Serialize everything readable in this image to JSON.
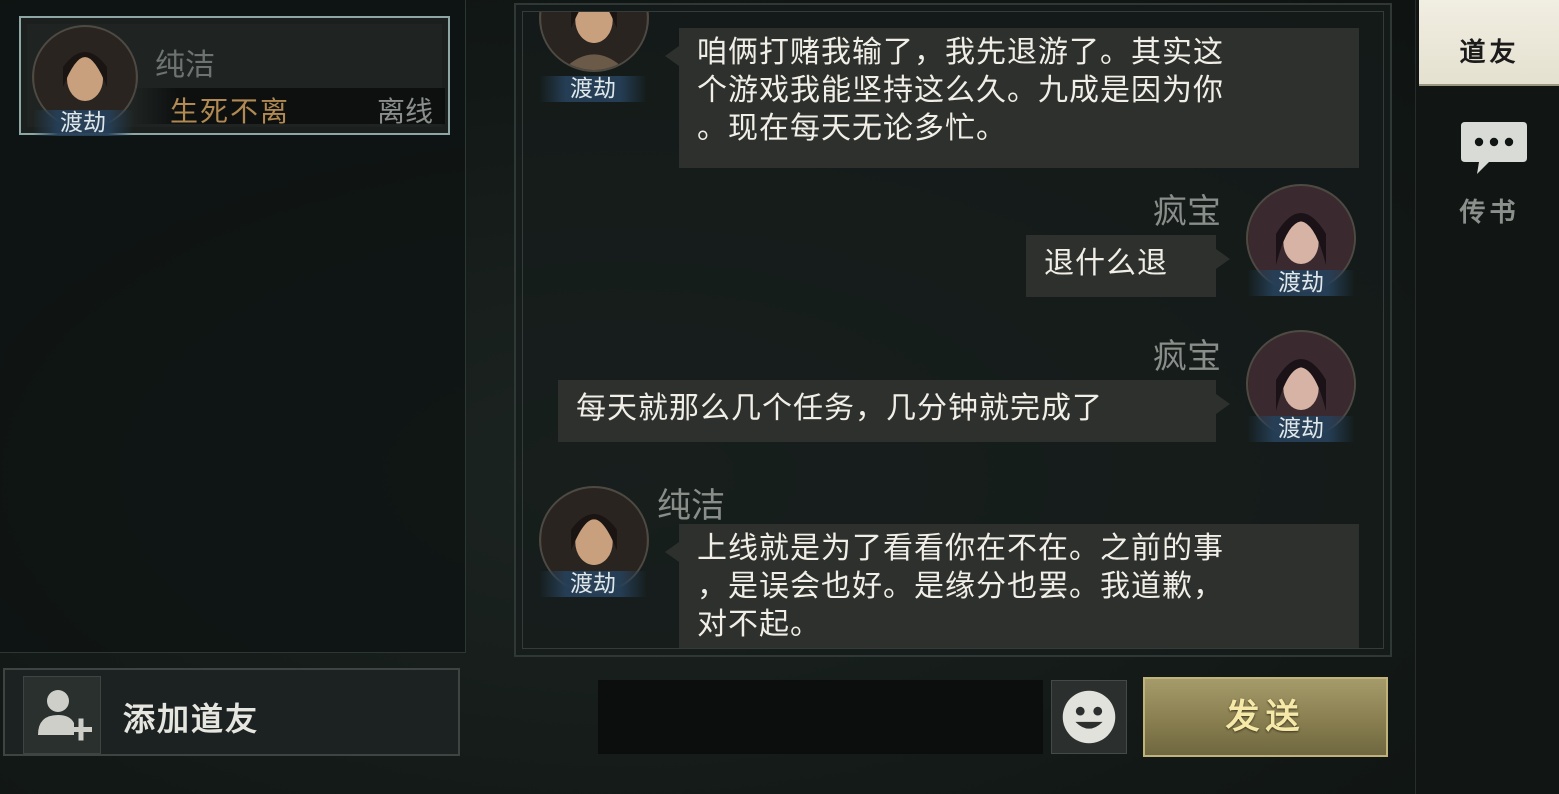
{
  "friend_list": {
    "friends": [
      {
        "name": "纯洁",
        "realm": "渡劫",
        "relation": "生死不离",
        "status": "离线"
      }
    ]
  },
  "add_friend": {
    "label": "添加道友",
    "icon": "add-user-icon"
  },
  "chat": {
    "messages": [
      {
        "side": "left",
        "sender": "",
        "realm": "渡劫",
        "lines": [
          "咱俩打赌我输了，我先退游了。其实这",
          "个游戏我能坚持这么久。九成是因为你",
          "。现在每天无论多忙。"
        ]
      },
      {
        "side": "right",
        "sender": "疯宝",
        "realm": "渡劫",
        "lines": [
          "退什么退"
        ]
      },
      {
        "side": "right",
        "sender": "疯宝",
        "realm": "渡劫",
        "lines": [
          "每天就那么几个任务，几分钟就完成了"
        ]
      },
      {
        "side": "left",
        "sender": "纯洁",
        "realm": "渡劫",
        "lines": [
          "上线就是为了看看你在不在。之前的事",
          "，是误会也好。是缘分也罢。我道歉，",
          "对不起。"
        ]
      }
    ]
  },
  "input": {
    "value": "",
    "placeholder": ""
  },
  "emoji_button": {
    "icon": "emoji-face-icon"
  },
  "send_button": {
    "label": "发送"
  },
  "tabs": [
    {
      "label": "道友",
      "active": true
    },
    {
      "label": "传书",
      "active": false,
      "icon": "chat-bubble-icon"
    }
  ],
  "colors": {
    "accent_gold": "#b08a52",
    "send_button": "#8b8152",
    "active_tab": "#f1eee2"
  }
}
